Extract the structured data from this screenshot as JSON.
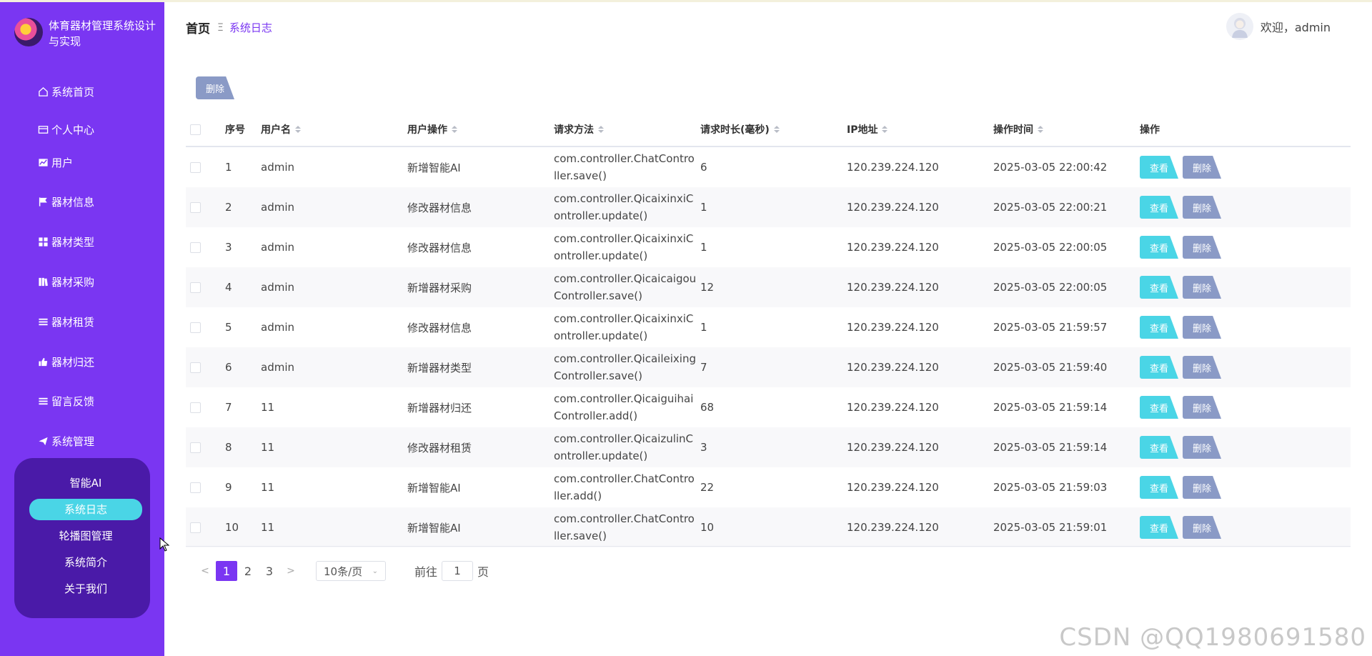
{
  "app": {
    "title": "体育器材管理系统设计与实现"
  },
  "sidebar": {
    "items": [
      {
        "label": "系统首页",
        "icon": "home-icon"
      },
      {
        "label": "个人中心",
        "icon": "card-icon"
      },
      {
        "label": "用户",
        "icon": "chart-icon"
      },
      {
        "label": "器材信息",
        "icon": "flag-icon"
      },
      {
        "label": "器材类型",
        "icon": "grid-icon"
      },
      {
        "label": "器材采购",
        "icon": "book-icon"
      },
      {
        "label": "器材租赁",
        "icon": "list-icon"
      },
      {
        "label": "器材归还",
        "icon": "thumb-icon"
      },
      {
        "label": "留言反馈",
        "icon": "list-icon"
      },
      {
        "label": "系统管理",
        "icon": "send-icon"
      }
    ],
    "submenu": [
      "智能AI",
      "系统日志",
      "轮播图管理",
      "系统简介",
      "关于我们"
    ],
    "active_sub": "系统日志"
  },
  "header": {
    "breadcrumb_home": "首页",
    "breadcrumb_sep": "Ξ",
    "breadcrumb_current": "系统日志",
    "welcome": "欢迎，admin"
  },
  "toolbar": {
    "delete_label": "删除"
  },
  "table": {
    "columns": [
      "序号",
      "用户名",
      "用户操作",
      "请求方法",
      "请求时长(毫秒)",
      "IP地址",
      "操作时间",
      "操作"
    ],
    "view_label": "查看",
    "delete_label": "删除",
    "rows": [
      {
        "no": "1",
        "user": "admin",
        "op": "新增智能AI",
        "method": "com.controller.ChatController.save()",
        "duration": "6",
        "ip": "120.239.224.120",
        "time": "2025-03-05 22:00:42"
      },
      {
        "no": "2",
        "user": "admin",
        "op": "修改器材信息",
        "method": "com.controller.QicaixinxiController.update()",
        "duration": "1",
        "ip": "120.239.224.120",
        "time": "2025-03-05 22:00:21"
      },
      {
        "no": "3",
        "user": "admin",
        "op": "修改器材信息",
        "method": "com.controller.QicaixinxiController.update()",
        "duration": "1",
        "ip": "120.239.224.120",
        "time": "2025-03-05 22:00:05"
      },
      {
        "no": "4",
        "user": "admin",
        "op": "新增器材采购",
        "method": "com.controller.QicaicaigouController.save()",
        "duration": "12",
        "ip": "120.239.224.120",
        "time": "2025-03-05 22:00:05"
      },
      {
        "no": "5",
        "user": "admin",
        "op": "修改器材信息",
        "method": "com.controller.QicaixinxiController.update()",
        "duration": "1",
        "ip": "120.239.224.120",
        "time": "2025-03-05 21:59:57"
      },
      {
        "no": "6",
        "user": "admin",
        "op": "新增器材类型",
        "method": "com.controller.QicaileixingController.save()",
        "duration": "7",
        "ip": "120.239.224.120",
        "time": "2025-03-05 21:59:40"
      },
      {
        "no": "7",
        "user": "11",
        "op": "新增器材归还",
        "method": "com.controller.QicaiguihaiController.add()",
        "duration": "68",
        "ip": "120.239.224.120",
        "time": "2025-03-05 21:59:14"
      },
      {
        "no": "8",
        "user": "11",
        "op": "修改器材租赁",
        "method": "com.controller.QicaizulinController.update()",
        "duration": "3",
        "ip": "120.239.224.120",
        "time": "2025-03-05 21:59:14"
      },
      {
        "no": "9",
        "user": "11",
        "op": "新增智能AI",
        "method": "com.controller.ChatController.add()",
        "duration": "22",
        "ip": "120.239.224.120",
        "time": "2025-03-05 21:59:03"
      },
      {
        "no": "10",
        "user": "11",
        "op": "新增智能AI",
        "method": "com.controller.ChatController.save()",
        "duration": "10",
        "ip": "120.239.224.120",
        "time": "2025-03-05 21:59:01"
      }
    ]
  },
  "pagination": {
    "prev": "<",
    "next": ">",
    "pages": [
      "1",
      "2",
      "3"
    ],
    "current": "1",
    "page_size": "10条/页",
    "goto_prefix": "前往",
    "goto_value": "1",
    "goto_suffix": "页"
  },
  "watermark": "CSDN @QQ1980691580",
  "colors": {
    "sidebar": "#7a36f2",
    "submenu": "#4a1aa8",
    "accent": "#4ad5e6",
    "delete": "#8a9ac6"
  }
}
